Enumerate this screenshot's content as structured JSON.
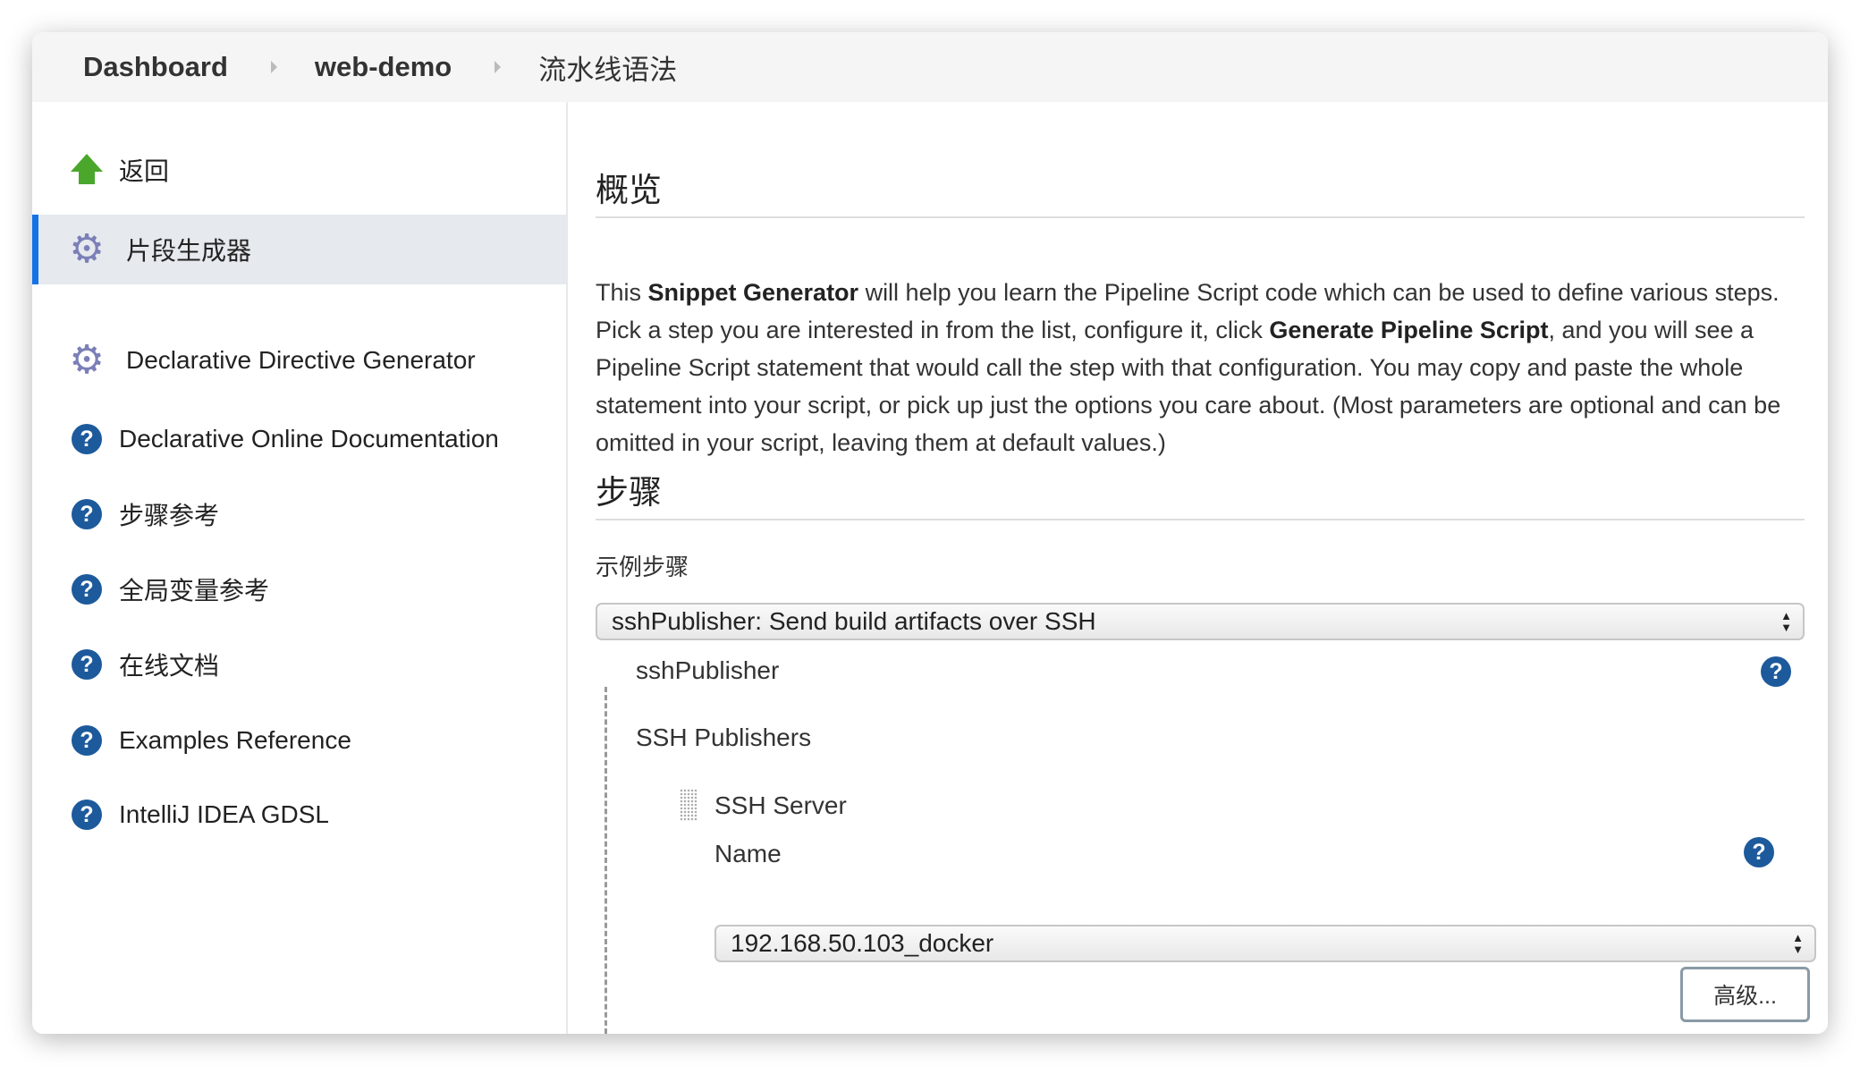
{
  "breadcrumb": [
    "Dashboard",
    "web-demo",
    "流水线语法"
  ],
  "sidebar": {
    "items": [
      {
        "label": "返回",
        "icon": "up-arrow-icon"
      },
      {
        "label": "片段生成器",
        "icon": "gear-icon",
        "selected": true
      },
      {
        "label": "Declarative Directive Generator",
        "icon": "gear-icon"
      },
      {
        "label": "Declarative Online Documentation",
        "icon": "help-icon"
      },
      {
        "label": "步骤参考",
        "icon": "help-icon"
      },
      {
        "label": "全局变量参考",
        "icon": "help-icon"
      },
      {
        "label": "在线文档",
        "icon": "help-icon"
      },
      {
        "label": "Examples Reference",
        "icon": "help-icon"
      },
      {
        "label": "IntelliJ IDEA GDSL",
        "icon": "help-icon"
      }
    ]
  },
  "main": {
    "overview_title": "概览",
    "para": [
      "This ",
      "Snippet Generator",
      " will help you learn the Pipeline Script code which can be used to define various steps. Pick a step you are interested in from the list, configure it, click ",
      "Generate Pipeline Script",
      ", and you will see a Pipeline Script statement that would call the step with that configuration. You may copy and paste the whole statement into your script, or pick up just the options you care about. (Most parameters are optional and can be omitted in your script, leaving them at default values.)"
    ],
    "steps_title": "步骤",
    "sample_step_label": "示例步骤",
    "sample_step_value": "sshPublisher: Send build artifacts over SSH",
    "step_name": "sshPublisher",
    "ssh_publishers_label": "SSH Publishers",
    "ssh_server_label": "SSH Server",
    "name_label": "Name",
    "name_value": "192.168.50.103_docker",
    "advanced_button": "高级...",
    "help_glyph": "?"
  },
  "colors": {
    "accent": "#1473e6",
    "help": "#1d5a9c",
    "back_arrow": "#4aa72c"
  }
}
